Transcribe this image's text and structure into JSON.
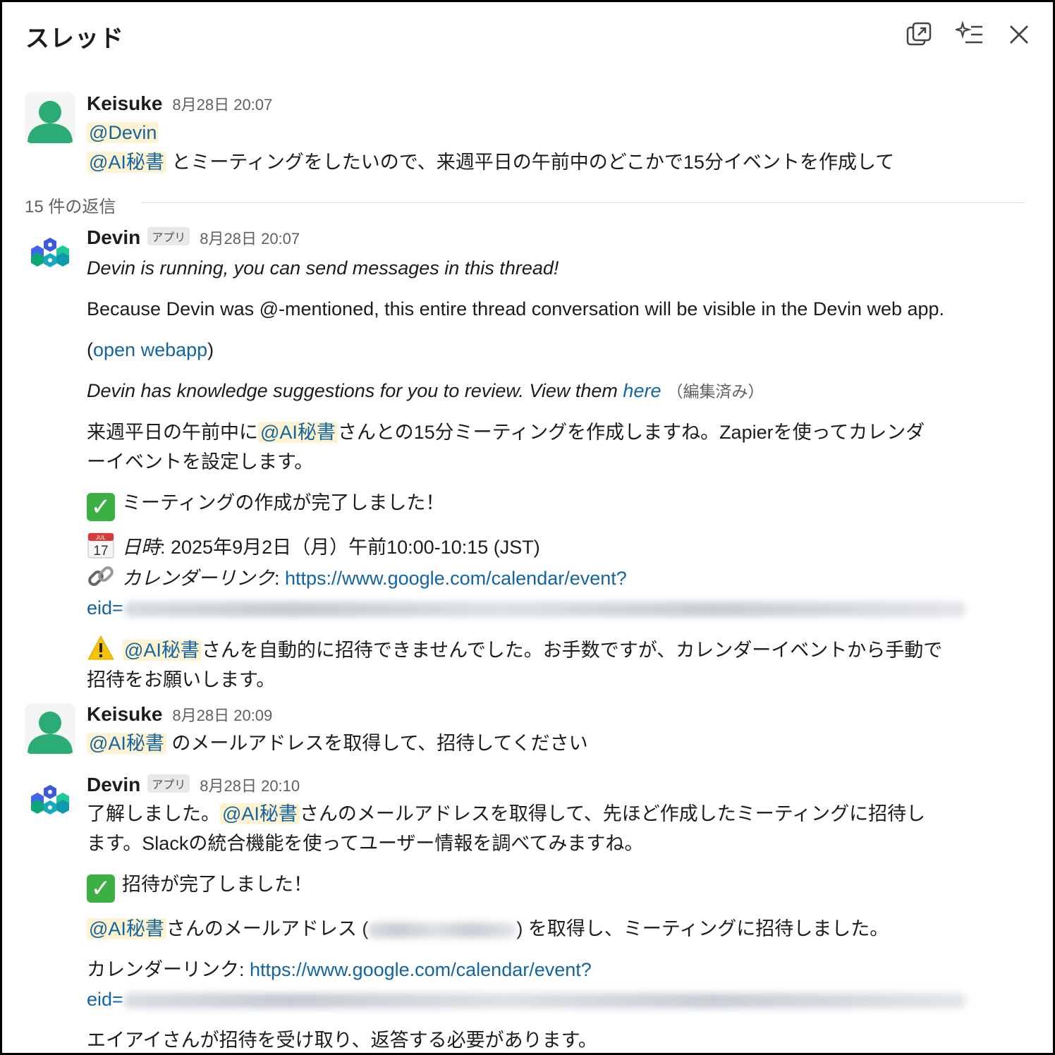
{
  "header": {
    "title": "スレッド",
    "icons": [
      "popout-icon",
      "ai-summary-icon",
      "close-icon"
    ]
  },
  "parent": {
    "author": "Keisuke",
    "time": "8月28日 20:07",
    "mention1": "@Devin",
    "mention2": "@AI秘書",
    "text": " とミーティングをしたいので、来週平日の午前中のどこかで15分イベントを作成して"
  },
  "divider": {
    "label": "15 件の返信"
  },
  "reply1": {
    "author": "Devin",
    "badge": "アプリ",
    "time": "8月28日 20:07",
    "running": "Devin is running, you can send messages in this thread!",
    "visible": "Because Devin was @-mentioned, this entire thread conversation will be visible in the Devin web app.",
    "open_pre": "(",
    "open_link": "open webapp",
    "open_post": ")",
    "knowledge": "Devin has knowledge suggestions for you to review. View them ",
    "knowledge_link": "here",
    "edited": "（編集済み）",
    "p1_pre": "来週平日の午前中に",
    "p1_mention": "@AI秘書",
    "p1_post": "さんとの15分ミーティングを作成しますね。Zapierを使ってカレンダ",
    "p1_line2": "ーイベントを設定します。",
    "done": "ミーティングの作成が完了しました！",
    "date_label": "日時",
    "date_value": ": 2025年9月2日（月）午前10:00-10:15 (JST)",
    "cal_day": "17",
    "cal_month": "JUL",
    "cal_label": "カレンダーリンク",
    "cal_sep": ": ",
    "cal_url": "https://www.google.com/calendar/event?",
    "cal_url2": "eid=",
    "warn_mention": "@AI秘書",
    "warn_text": "さんを自動的に招待できませんでした。お手数ですが、カレンダーイベントから手動で",
    "warn_line2": "招待をお願いします。"
  },
  "reply2": {
    "author": "Keisuke",
    "time": "8月28日 20:09",
    "mention": "@AI秘書",
    "text": " のメールアドレスを取得して、招待してください"
  },
  "reply3": {
    "author": "Devin",
    "badge": "アプリ",
    "time": "8月28日 20:10",
    "p1_pre": "了解しました。",
    "p1_mention": "@AI秘書",
    "p1_post": "さんのメールアドレスを取得して、先ほど作成したミーティングに招待し",
    "p1_line2": "ます。Slackの統合機能を使ってユーザー情報を調べてみますね。",
    "done": "招待が完了しました！",
    "p2_mention": "@AI秘書",
    "p2_pre": "さんのメールアドレス (",
    "p2_post": ") を取得し、ミーティングに招待しました。",
    "cal_label": "カレンダーリンク: ",
    "cal_url": "https://www.google.com/calendar/event?",
    "cal_url2": "eid=",
    "last": "エイアイさんが招待を受け取り、返答する必要があります。"
  },
  "colors": {
    "link": "#1264a3",
    "mention_bg": "#fdf3d1",
    "avatar_green": "#2bac76",
    "check_green": "#3cb043"
  }
}
